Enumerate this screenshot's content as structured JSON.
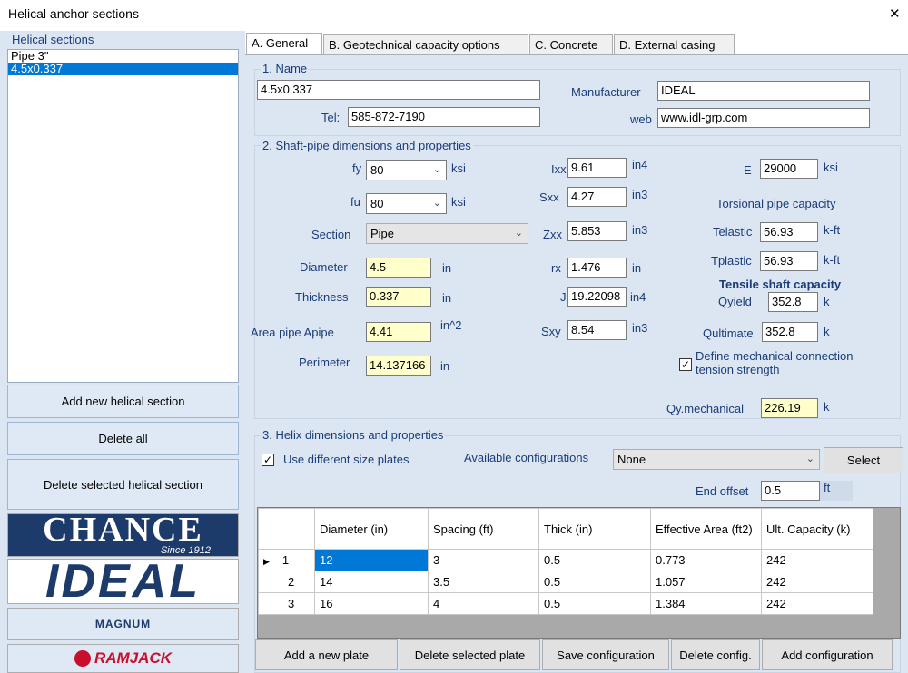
{
  "window": {
    "title": "Helical anchor sections",
    "close_glyph": "✕"
  },
  "left_panel": {
    "header": "Helical sections",
    "items": [
      "Pipe 3\"",
      "4.5x0.337"
    ],
    "selected_index": 1,
    "buttons": {
      "add": "Add new helical section",
      "delete_all": "Delete all",
      "delete_selected": "Delete selected helical section"
    },
    "logos": {
      "chance": "CHANCE",
      "chance_sub": "Since 1912",
      "ideal": "IDEAL",
      "magnum": "MAGNUM",
      "ramjack": "RAMJACK"
    }
  },
  "tabs": [
    "A. General",
    "B. Geotechnical capacity options",
    "C. Concrete",
    "D. External casing"
  ],
  "active_tab": 0,
  "name_section": {
    "title": "1. Name",
    "name_value": "4.5x0.337",
    "tel_label": "Tel:",
    "tel_value": "585-872-7190",
    "manufacturer_label": "Manufacturer",
    "manufacturer_value": "IDEAL",
    "web_label": "web",
    "web_value": "www.idl-grp.com"
  },
  "shaft_section": {
    "title": "2. Shaft-pipe dimensions and properties",
    "fy": {
      "label": "fy",
      "value": "80",
      "unit": "ksi"
    },
    "fu": {
      "label": "fu",
      "value": "80",
      "unit": "ksi"
    },
    "section": {
      "label": "Section",
      "value": "Pipe"
    },
    "diameter": {
      "label": "Diameter",
      "value": "4.5",
      "unit": "in"
    },
    "thickness": {
      "label": "Thickness",
      "value": "0.337",
      "unit": "in"
    },
    "area": {
      "label": "Area pipe Apipe",
      "value": "4.41",
      "unit": "in^2"
    },
    "perimeter": {
      "label": "Perimeter",
      "value": "14.137166",
      "unit": "in"
    },
    "ixx": {
      "label": "Ixx",
      "value": "9.61",
      "unit": "in4"
    },
    "sxx": {
      "label": "Sxx",
      "value": "4.27",
      "unit": "in3"
    },
    "zxx": {
      "label": "Zxx",
      "value": "5.853",
      "unit": "in3"
    },
    "rx": {
      "label": "rx",
      "value": "1.476",
      "unit": "in"
    },
    "j": {
      "label": "J",
      "value": "19.22098",
      "unit": "in4"
    },
    "sxy": {
      "label": "Sxy",
      "value": "8.54",
      "unit": "in3"
    },
    "e": {
      "label": "E",
      "value": "29000",
      "unit": "ksi"
    },
    "torsional_title": "Torsional pipe capacity",
    "telastic": {
      "label": "Telastic",
      "value": "56.93",
      "unit": "k-ft"
    },
    "tplastic": {
      "label": "Tplastic",
      "value": "56.93",
      "unit": "k-ft"
    },
    "tensile_title": "Tensile shaft capacity",
    "qyield": {
      "label": "Qyield",
      "value": "352.8",
      "unit": "k"
    },
    "qultimate": {
      "label": "Qultimate",
      "value": "352.8",
      "unit": "k"
    },
    "define_mech_label": "Define mechanical connection tension strength",
    "define_mech_checked": true,
    "qymech": {
      "label": "Qy.mechanical",
      "value": "226.19",
      "unit": "k"
    }
  },
  "helix_section": {
    "title": "3. Helix dimensions and properties",
    "use_diff_label": "Use different size plates",
    "use_diff_checked": true,
    "available_label": "Available configurations",
    "available_value": "None",
    "select_button": "Select",
    "end_offset_label": "End offset",
    "end_offset_value": "0.5",
    "end_offset_unit": "ft",
    "table": {
      "columns": [
        "Diameter (in)",
        "Spacing (ft)",
        "Thick (in)",
        "Effective Area (ft2)",
        "Ult. Capacity (k)"
      ],
      "rows": [
        {
          "n": "1",
          "cells": [
            "12",
            "3",
            "0.5",
            "0.773",
            "242"
          ]
        },
        {
          "n": "2",
          "cells": [
            "14",
            "3.5",
            "0.5",
            "1.057",
            "242"
          ]
        },
        {
          "n": "3",
          "cells": [
            "16",
            "4",
            "0.5",
            "1.384",
            "242"
          ]
        }
      ]
    },
    "buttons": {
      "add_plate": "Add a new plate",
      "delete_plate": "Delete selected plate",
      "save_config": "Save configuration",
      "delete_config": "Delete config.",
      "add_config": "Add configuration"
    }
  },
  "colors": {
    "panel_bg": "#dce6f3",
    "selection": "#0078d7",
    "input_yellow": "#ffffcc",
    "label_blue": "#1a3c78"
  }
}
